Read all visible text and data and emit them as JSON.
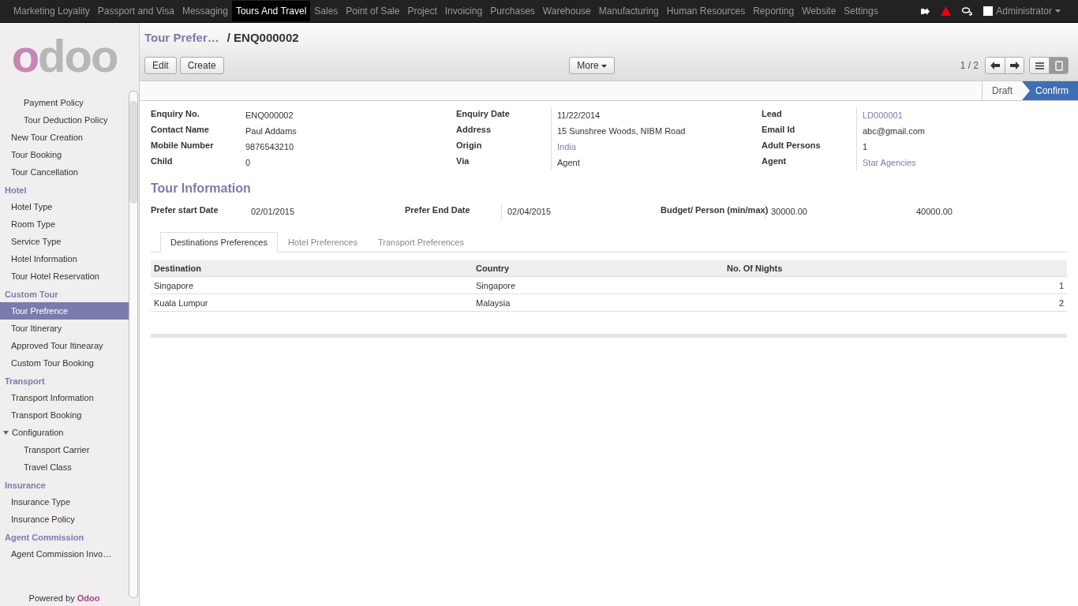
{
  "top_menu": [
    {
      "label": "Marketing Loyality",
      "selected": false
    },
    {
      "label": "Passport and Visa",
      "selected": false
    },
    {
      "label": "Messaging",
      "selected": false
    },
    {
      "label": "Tours And Travel",
      "selected": true
    },
    {
      "label": "Sales",
      "selected": false
    },
    {
      "label": "Point of Sale",
      "selected": false
    },
    {
      "label": "Project",
      "selected": false
    },
    {
      "label": "Invoicing",
      "selected": false
    },
    {
      "label": "Purchases",
      "selected": false
    },
    {
      "label": "Warehouse",
      "selected": false
    },
    {
      "label": "Manufacturing",
      "selected": false
    },
    {
      "label": "Human Resources",
      "selected": false
    },
    {
      "label": "Reporting",
      "selected": false
    },
    {
      "label": "Website",
      "selected": false
    },
    {
      "label": "Settings",
      "selected": false
    }
  ],
  "user": {
    "name": "Administrator"
  },
  "logo": "odoo",
  "sidebar": {
    "sections": [
      {
        "items": [
          {
            "children": [
              {
                "label": "Payment Policy",
                "selected": false
              },
              {
                "label": "Tour Deduction Policy",
                "selected": false
              }
            ]
          },
          {
            "label": "New Tour Creation",
            "selected": false
          },
          {
            "label": "Tour Booking",
            "selected": false
          },
          {
            "label": "Tour Cancellation",
            "selected": false
          }
        ]
      },
      {
        "heading": "Hotel",
        "items": [
          {
            "label": "Hotel Type",
            "selected": false
          },
          {
            "label": "Room Type",
            "selected": false
          },
          {
            "label": "Service Type",
            "selected": false
          },
          {
            "label": "Hotel Information",
            "selected": false
          },
          {
            "label": "Tour Hotel Reservation",
            "selected": false
          }
        ]
      },
      {
        "heading": "Custom Tour",
        "items": [
          {
            "label": "Tour Prefrence",
            "selected": true
          },
          {
            "label": "Tour Itinerary",
            "selected": false
          },
          {
            "label": "Approved Tour Itinearay",
            "selected": false
          },
          {
            "label": "Custom Tour Booking",
            "selected": false
          }
        ]
      },
      {
        "heading": "Transport",
        "items": [
          {
            "label": "Transport Information",
            "selected": false
          },
          {
            "label": "Transport Booking",
            "selected": false
          },
          {
            "label": "Configuration",
            "selected": false,
            "expanded": true,
            "children": [
              {
                "label": "Transport Carrier",
                "selected": false
              },
              {
                "label": "Travel Class",
                "selected": false
              }
            ]
          }
        ]
      },
      {
        "heading": "Insurance",
        "items": [
          {
            "label": "Insurance Type",
            "selected": false
          },
          {
            "label": "Insurance Policy",
            "selected": false
          }
        ]
      },
      {
        "heading": "Agent Commission",
        "items": [
          {
            "label": "Agent Commission Invo…",
            "selected": false
          }
        ]
      }
    ],
    "footer": "Powered by **Odoo**"
  },
  "breadcrumb": {
    "parent": "Tour Prefer…",
    "current": "/ ENQ000002"
  },
  "buttons": [
    "Edit",
    "Create"
  ],
  "more_button": "More",
  "pager": "1 / 2",
  "view_switch": [
    {
      "kind": "list",
      "selected": false
    },
    {
      "kind": "form",
      "selected": true
    }
  ],
  "status_steps": [
    {
      "label": "Draft",
      "selected": false
    },
    {
      "label": "Confirm",
      "selected": true
    }
  ],
  "fields": [
    [
      {
        "label": "Enquiry No.",
        "value": "ENQ000002",
        "link": false
      },
      {
        "label": "Contact Name",
        "value": "Paul Addams",
        "link": false
      },
      {
        "label": "Mobile Number",
        "value": "9876543210",
        "link": false
      },
      {
        "label": "Child",
        "value": "0",
        "link": false
      }
    ],
    [
      {
        "label": "Enquiry Date",
        "value": "11/22/2014",
        "link": false
      },
      {
        "label": "Address",
        "value": "15 Sunshree Woods, NIBM Road",
        "link": false
      },
      {
        "label": "Origin",
        "value": "India",
        "link": true
      },
      {
        "label": "Via",
        "value": "Agent",
        "link": false
      }
    ],
    [
      {
        "label": "Lead",
        "value": "LD000001",
        "link": true
      },
      {
        "label": "Email Id",
        "value": "abc@gmail.com",
        "link": false
      },
      {
        "label": "Adult Persons",
        "value": "1",
        "link": false
      },
      {
        "label": "Agent",
        "value": "Star Agencies",
        "link": true
      }
    ]
  ],
  "section_title": "Tour Information",
  "tour_fields": [
    {
      "label": "Prefer start Date",
      "values": [
        "02/01/2015"
      ]
    },
    {
      "label": "Prefer End Date",
      "values": [
        "02/04/2015"
      ]
    },
    {
      "label": "Budget/ Person (min/max)",
      "values": [
        "30000.00",
        "40000.00"
      ]
    }
  ],
  "tabs": [
    {
      "label": "Destinations Preferences",
      "selected": true
    },
    {
      "label": "Hotel Preferences",
      "selected": false
    },
    {
      "label": "Transport Preferences",
      "selected": false
    }
  ],
  "table": {
    "columns": [
      "Destination",
      "Country",
      "No. Of Nights"
    ],
    "rows": [
      [
        "Singapore",
        "Singapore",
        "1"
      ],
      [
        "Kuala Lumpur",
        "Malaysia",
        "2"
      ]
    ]
  }
}
